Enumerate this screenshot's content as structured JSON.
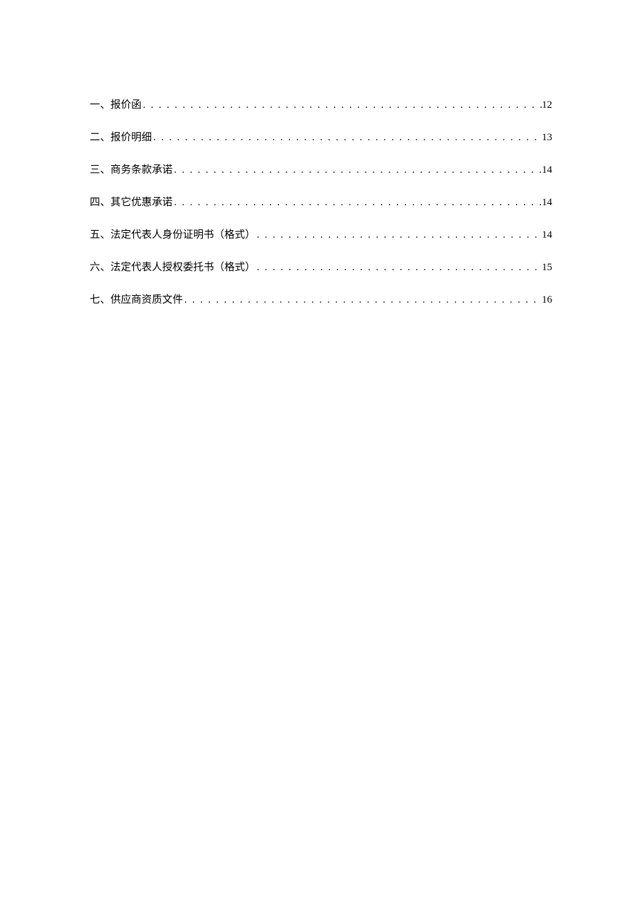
{
  "toc": [
    {
      "label": "一、报价函",
      "page": "12"
    },
    {
      "label": "二、报价明细",
      "page": "13"
    },
    {
      "label": "三、商务条款承诺",
      "page": "14"
    },
    {
      "label": "四、其它优惠承诺",
      "page": "14"
    },
    {
      "label": "五、法定代表人身份证明书（格式）",
      "page": "14"
    },
    {
      "label": "六、法定代表人授权委托书（格式）",
      "page": "15"
    },
    {
      "label": "七、供应商资质文件",
      "page": "16"
    }
  ],
  "dots": ". . . . . . . . . . . . . . . . . . . . . . . . . . . . . . . . . . . . . . . . . . . . . . . . . . . . . . . . . . . . . . . . . . . . . . . . . . . . . . . . . . . . . . . . . . . . . . . . . . . ."
}
